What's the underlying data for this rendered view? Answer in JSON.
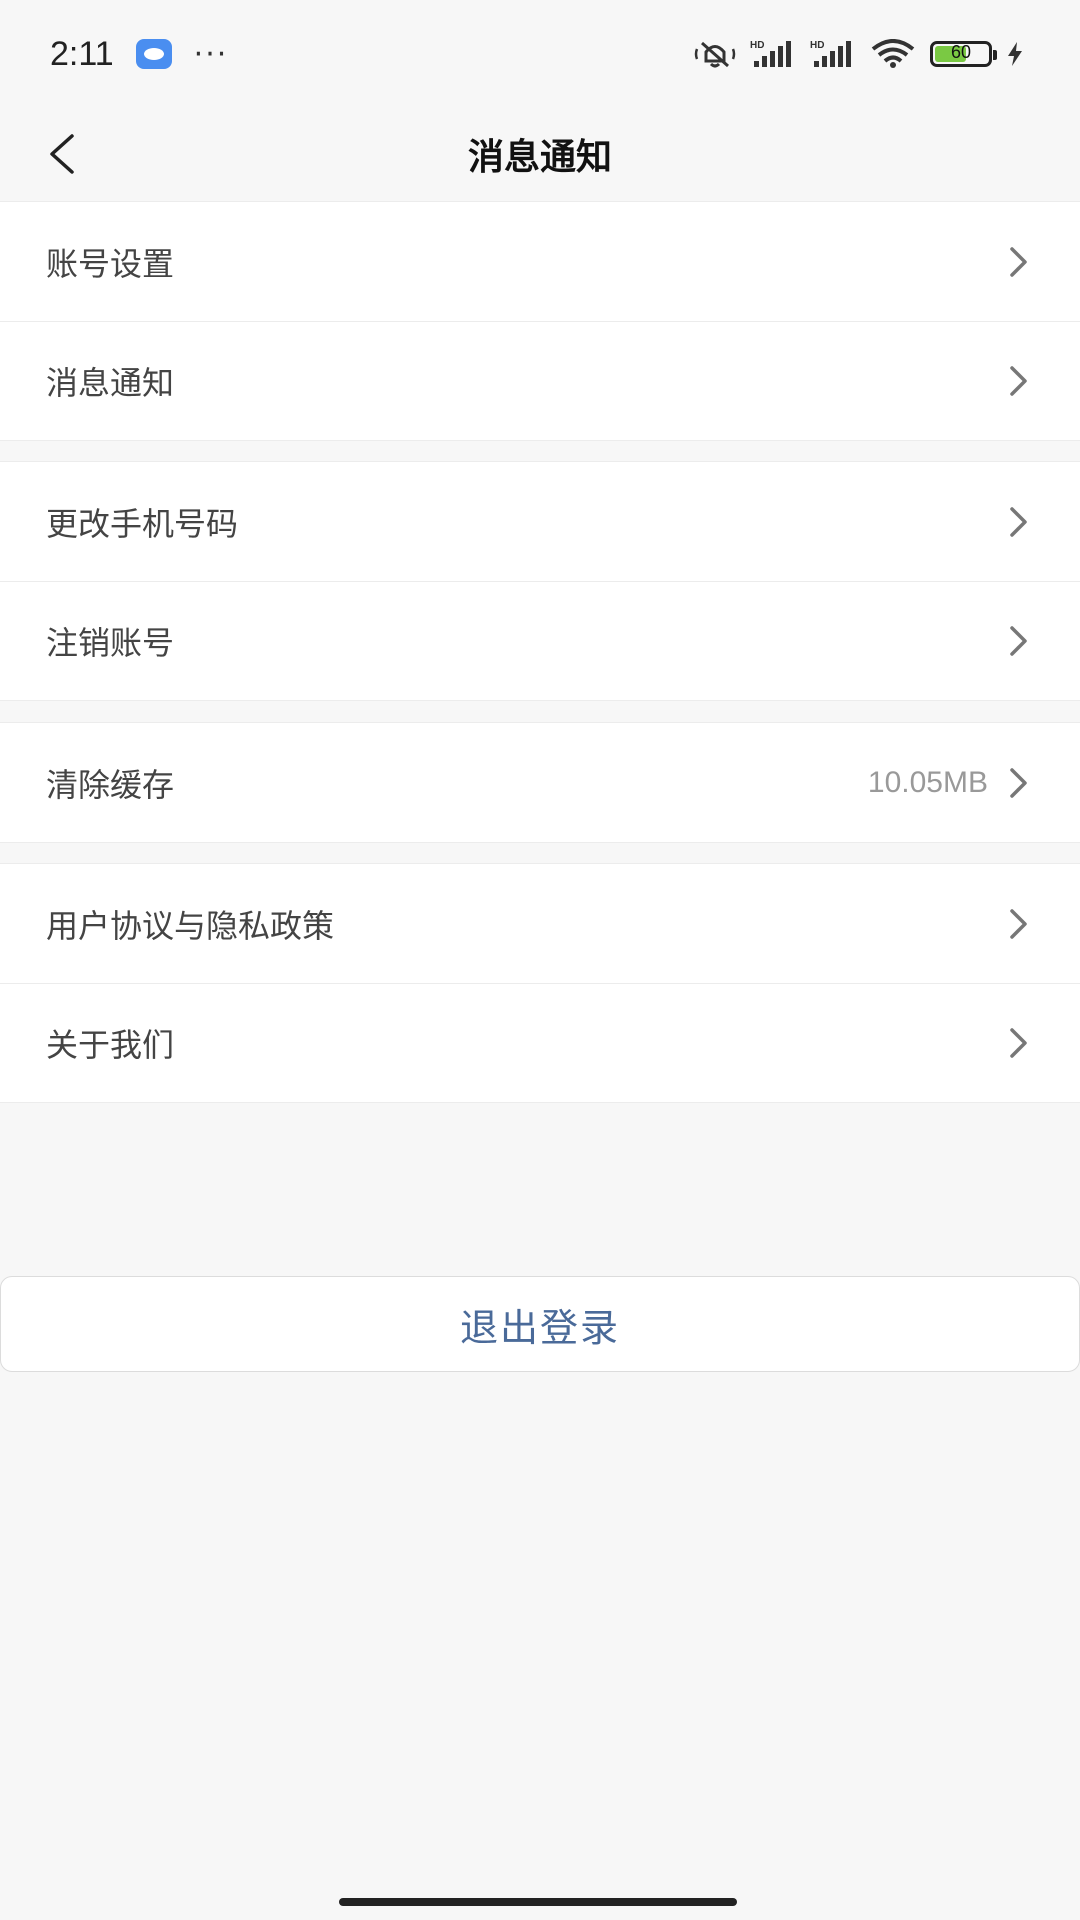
{
  "status_bar": {
    "time": "2:11",
    "more": "···",
    "battery_level": "60",
    "icons": [
      "silent-icon",
      "signal-hd-icon",
      "signal-hd-icon",
      "wifi-icon",
      "battery-icon",
      "charging-icon"
    ]
  },
  "header": {
    "title": "消息通知"
  },
  "groups": [
    {
      "items": [
        {
          "label": "账号设置"
        },
        {
          "label": "消息通知"
        }
      ]
    },
    {
      "items": [
        {
          "label": "更改手机号码"
        },
        {
          "label": "注销账号"
        }
      ]
    },
    {
      "items": [
        {
          "label": "清除缓存",
          "value": "10.05MB"
        }
      ]
    },
    {
      "items": [
        {
          "label": "用户协议与隐私政策"
        },
        {
          "label": "关于我们"
        }
      ]
    }
  ],
  "logout": {
    "label": "退出登录"
  },
  "colors": {
    "background": "#f7f7f7",
    "logout_text": "#4a6a99",
    "battery_fill": "#7ac943"
  }
}
